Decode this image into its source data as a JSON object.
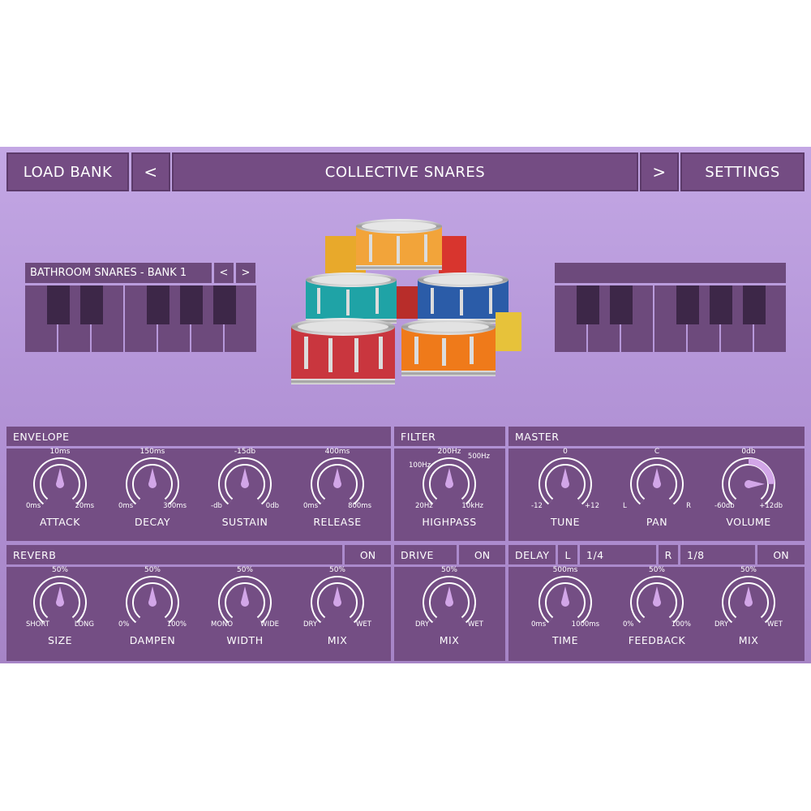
{
  "header": {
    "load_bank": "LOAD BANK",
    "prev": "<",
    "title": "COLLECTIVE SNARES",
    "next": ">",
    "settings": "SETTINGS"
  },
  "left_keyboard": {
    "bank_name": "BATHROOM SNARES - BANK 1",
    "prev": "<",
    "next": ">"
  },
  "right_keyboard": {
    "bank_name": ""
  },
  "envelope": {
    "title": "ENVELOPE",
    "knobs": [
      {
        "name": "ATTACK",
        "value": "10ms",
        "min": "0ms",
        "max": "20ms",
        "level": 0.5
      },
      {
        "name": "DECAY",
        "value": "150ms",
        "min": "0ms",
        "max": "300ms",
        "level": 0.5
      },
      {
        "name": "SUSTAIN",
        "value": "-15db",
        "min": "-db",
        "max": "0db",
        "level": 0.5
      },
      {
        "name": "RELEASE",
        "value": "400ms",
        "min": "0ms",
        "max": "800ms",
        "level": 0.5
      }
    ]
  },
  "filter": {
    "title": "FILTER",
    "knob": {
      "name": "HIGHPASS",
      "value": "200Hz",
      "min": "20Hz",
      "max": "10kHz",
      "left": "100Hz",
      "right": "500Hz",
      "level": 0.5
    }
  },
  "master": {
    "title": "MASTER",
    "knobs": [
      {
        "name": "TUNE",
        "value": "0",
        "min": "-12",
        "max": "+12",
        "level": 0.5
      },
      {
        "name": "PAN",
        "value": "C",
        "min": "L",
        "max": "R",
        "level": 0.5
      },
      {
        "name": "VOLUME",
        "value": "0db",
        "min": "-60db",
        "max": "+12db",
        "level": 0.82
      }
    ]
  },
  "reverb": {
    "title": "REVERB",
    "toggle": "ON",
    "knobs": [
      {
        "name": "SIZE",
        "value": "50%",
        "min": "SHORT",
        "max": "LONG",
        "level": 0.5
      },
      {
        "name": "DAMPEN",
        "value": "50%",
        "min": "0%",
        "max": "100%",
        "level": 0.5
      },
      {
        "name": "WIDTH",
        "value": "50%",
        "min": "MONO",
        "max": "WIDE",
        "level": 0.5
      },
      {
        "name": "MIX",
        "value": "50%",
        "min": "DRY",
        "max": "WET",
        "level": 0.5
      }
    ]
  },
  "drive": {
    "title": "DRIVE",
    "toggle": "ON",
    "knob": {
      "name": "MIX",
      "value": "50%",
      "min": "DRY",
      "max": "WET",
      "level": 0.5
    }
  },
  "delay": {
    "title": "DELAY",
    "left_label": "L",
    "left_value": "1/4",
    "right_label": "R",
    "right_value": "1/8",
    "toggle": "ON",
    "knobs": [
      {
        "name": "TIME",
        "value": "500ms",
        "min": "0ms",
        "max": "1000ms",
        "level": 0.5
      },
      {
        "name": "FEEDBACK",
        "value": "50%",
        "min": "0%",
        "max": "100%",
        "level": 0.5
      },
      {
        "name": "MIX",
        "value": "50%",
        "min": "DRY",
        "max": "WET",
        "level": 0.5
      }
    ]
  },
  "colors": {
    "arc_fill": "#d2a6e8",
    "arc_track": "#ffffff",
    "panel": "#744e84",
    "key_black": "#3d2748"
  }
}
